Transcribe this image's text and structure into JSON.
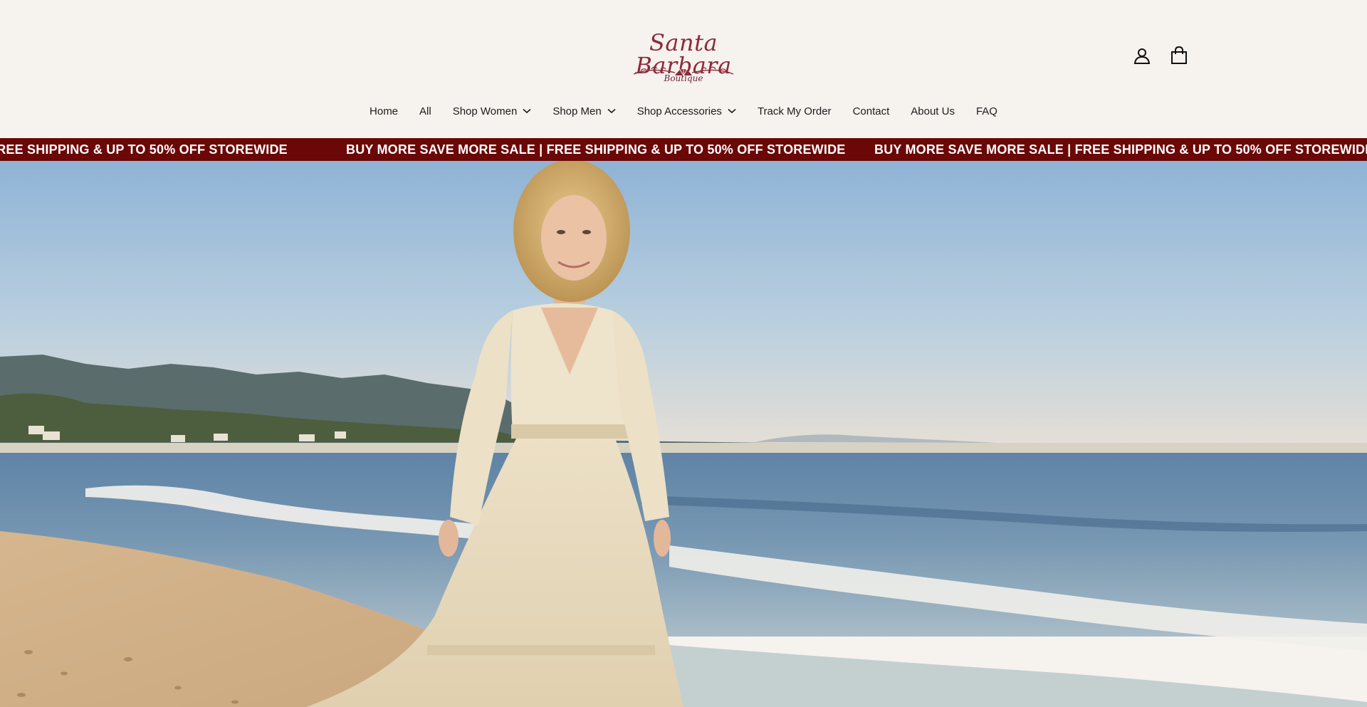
{
  "brand": {
    "name": "Santa Barbara",
    "subtitle": "Boutique"
  },
  "header": {
    "account_icon": "account-icon",
    "cart_icon": "cart-icon"
  },
  "nav": {
    "items": [
      {
        "label": "Home",
        "dropdown": false
      },
      {
        "label": "All",
        "dropdown": false
      },
      {
        "label": "Shop Women",
        "dropdown": true
      },
      {
        "label": "Shop Men",
        "dropdown": true
      },
      {
        "label": "Shop Accessories",
        "dropdown": true
      },
      {
        "label": "Track My Order",
        "dropdown": false
      },
      {
        "label": "Contact",
        "dropdown": false
      },
      {
        "label": "About Us",
        "dropdown": false
      },
      {
        "label": "FAQ",
        "dropdown": false
      }
    ]
  },
  "announcement": {
    "text_partial": "FREE SHIPPING & UP TO 50% OFF STOREWIDE",
    "text": "BUY MORE SAVE MORE SALE | FREE SHIPPING & UP TO 50% OFF STOREWIDE",
    "background": "#6b0707",
    "color": "#ffffff"
  },
  "colors": {
    "page_bg": "#f6f2ee",
    "brand": "#8d2a3b"
  }
}
